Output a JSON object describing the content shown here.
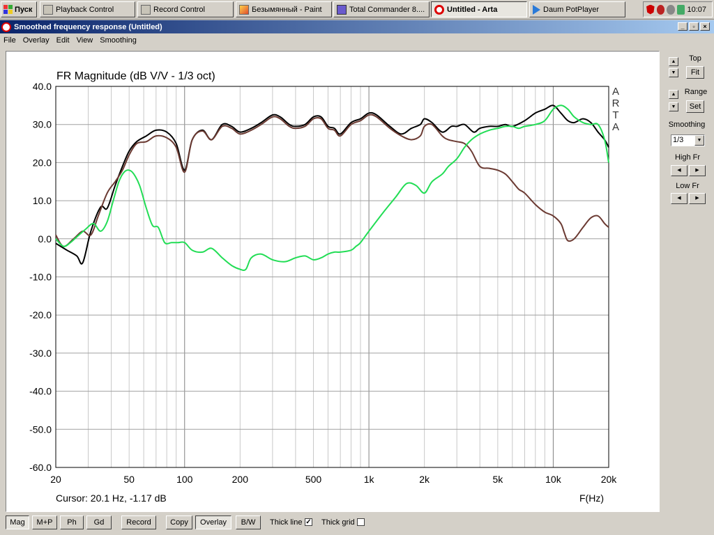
{
  "taskbar": {
    "start_label": "Пуск",
    "tasks": [
      {
        "label": "Playback Control",
        "icon": "mixer-icon"
      },
      {
        "label": "Record Control",
        "icon": "mixer-icon"
      },
      {
        "label": "Безымянный - Paint",
        "icon": "paint-icon"
      },
      {
        "label": "Total Commander 8....",
        "icon": "floppy-icon"
      },
      {
        "label": "Untitled - Arta",
        "icon": "arta-icon"
      },
      {
        "label": "Daum PotPlayer",
        "icon": "play-icon"
      }
    ],
    "clock": "10:07"
  },
  "window": {
    "title": "Smoothed frequency response (Untitled)",
    "controls": [
      "_",
      "▫",
      "×"
    ]
  },
  "menu": [
    "File",
    "Overlay",
    "Edit",
    "View",
    "Smoothing"
  ],
  "chart_data": {
    "type": "line",
    "title": "FR Magnitude (dB V/V - 1/3 oct)",
    "xlabel": "F(Hz)",
    "ylabel": "",
    "x_scale": "log",
    "xlim": [
      20,
      20000
    ],
    "ylim": [
      -60,
      40
    ],
    "x_ticks": [
      {
        "v": 20,
        "label": "20"
      },
      {
        "v": 50,
        "label": "50"
      },
      {
        "v": 100,
        "label": "100"
      },
      {
        "v": 200,
        "label": "200"
      },
      {
        "v": 500,
        "label": "500"
      },
      {
        "v": 1000,
        "label": "1k"
      },
      {
        "v": 2000,
        "label": "2k"
      },
      {
        "v": 5000,
        "label": "5k"
      },
      {
        "v": 10000,
        "label": "10k"
      },
      {
        "v": 20000,
        "label": "20k"
      }
    ],
    "y_ticks": [
      {
        "v": 40,
        "label": "40.0"
      },
      {
        "v": 30,
        "label": "30.0"
      },
      {
        "v": 20,
        "label": "20.0"
      },
      {
        "v": 10,
        "label": "10.0"
      },
      {
        "v": 0,
        "label": "0.0"
      },
      {
        "v": -10,
        "label": "-10.0"
      },
      {
        "v": -20,
        "label": "-20.0"
      },
      {
        "v": -30,
        "label": "-30.0"
      },
      {
        "v": -40,
        "label": "-40.0"
      },
      {
        "v": -50,
        "label": "-50.0"
      },
      {
        "v": -60,
        "label": "-60.0"
      }
    ],
    "grid": true,
    "watermark": [
      "A",
      "R",
      "T",
      "A"
    ],
    "cursor_text": "Cursor: 20.1 Hz, -1.17 dB",
    "series": [
      {
        "color": "#000000",
        "x": [
          20,
          23,
          26,
          28,
          31,
          35,
          38,
          42,
          46,
          50,
          55,
          62,
          70,
          80,
          90,
          100,
          110,
          125,
          140,
          160,
          180,
          200,
          230,
          260,
          300,
          330,
          370,
          400,
          450,
          500,
          550,
          600,
          650,
          700,
          800,
          900,
          1000,
          1100,
          1300,
          1500,
          1700,
          1900,
          2000,
          2200,
          2500,
          2800,
          3000,
          3300,
          3700,
          4000,
          4500,
          5000,
          5500,
          6000,
          7000,
          8000,
          9000,
          10000,
          11000,
          12000,
          13000,
          14500,
          16000,
          17500,
          19000,
          20000
        ],
        "y": [
          -1.2,
          -3,
          -4.5,
          -6.3,
          2,
          8.3,
          8,
          14,
          19,
          23,
          25.5,
          27,
          28.5,
          28,
          25,
          18,
          26,
          28.5,
          26,
          30,
          29.5,
          28,
          29,
          30.5,
          32.5,
          32,
          30,
          29.5,
          30,
          32,
          32,
          29.5,
          29,
          27.5,
          30.5,
          31.5,
          33,
          32.5,
          29.5,
          27.5,
          29,
          30,
          31.5,
          30.5,
          28,
          29.5,
          29.5,
          30,
          28,
          29,
          29.5,
          29.5,
          30,
          29.5,
          31,
          33,
          34,
          35,
          33,
          31,
          30.5,
          31.5,
          30.5,
          28,
          26,
          24
        ]
      },
      {
        "color": "#6b3a32",
        "x": [
          20,
          22,
          25,
          28,
          31,
          34,
          38,
          42,
          46,
          50,
          55,
          62,
          70,
          80,
          90,
          100,
          110,
          125,
          140,
          160,
          180,
          200,
          230,
          260,
          300,
          330,
          370,
          400,
          450,
          500,
          550,
          600,
          650,
          700,
          800,
          900,
          1000,
          1100,
          1300,
          1500,
          1700,
          1900,
          2000,
          2200,
          2500,
          2700,
          3000,
          3300,
          3600,
          4000,
          4500,
          5000,
          5500,
          6000,
          6500,
          7000,
          8000,
          9000,
          10000,
          11000,
          11500,
          12000,
          13000,
          14500,
          16000,
          17500,
          19000,
          20000
        ],
        "y": [
          1,
          -2,
          0,
          2,
          1,
          6,
          12,
          15,
          18,
          22,
          25,
          25.5,
          27,
          26.5,
          24,
          17.5,
          26,
          28.3,
          26,
          29.5,
          29,
          27.5,
          28.5,
          30,
          32,
          31.5,
          29.5,
          29,
          29.5,
          31.5,
          31.5,
          29,
          28.5,
          27,
          30,
          31,
          32.5,
          32,
          29,
          27,
          26,
          27,
          29.5,
          30,
          27,
          26,
          25.5,
          25,
          23,
          19,
          18.5,
          18,
          17,
          15,
          13,
          12,
          9,
          7,
          6,
          4,
          1.5,
          -0.5,
          0,
          3,
          5.5,
          6,
          4,
          3
        ]
      },
      {
        "color": "#22dd55",
        "x": [
          20,
          22,
          24,
          26,
          29,
          32,
          35,
          38,
          41,
          44,
          47,
          50,
          53,
          57,
          62,
          67,
          72,
          78,
          85,
          92,
          100,
          110,
          125,
          140,
          160,
          180,
          200,
          215,
          230,
          260,
          300,
          350,
          400,
          450,
          500,
          550,
          600,
          650,
          700,
          800,
          850,
          900,
          1000,
          1200,
          1400,
          1600,
          1800,
          2000,
          2200,
          2500,
          2700,
          3000,
          3300,
          3600,
          4000,
          4500,
          5000,
          5500,
          6000,
          6500,
          7000,
          8000,
          9000,
          10000,
          11000,
          12000,
          13000,
          14500,
          16000,
          17500,
          19000,
          20000
        ],
        "y": [
          0,
          -2,
          -1,
          0.5,
          2.5,
          4,
          2,
          4.5,
          10,
          15,
          17.5,
          18,
          17,
          14,
          8,
          3.5,
          3,
          -1,
          -1,
          -1,
          -1,
          -3,
          -3.5,
          -2.5,
          -5,
          -7,
          -8,
          -8,
          -5,
          -4,
          -5.5,
          -6,
          -5,
          -4.5,
          -5.5,
          -5,
          -4,
          -3.5,
          -3.5,
          -3,
          -2,
          -1,
          2,
          7,
          11,
          14.5,
          14,
          12,
          15,
          17,
          19,
          21,
          24,
          26,
          27.5,
          28.5,
          29,
          29.5,
          29.5,
          29,
          29.5,
          30,
          31,
          34,
          35,
          34,
          32,
          30.5,
          30,
          30,
          26,
          20
        ]
      }
    ]
  },
  "side_panel": {
    "top_label": "Top",
    "fit_label": "Fit",
    "range_label": "Range",
    "set_label": "Set",
    "smoothing_label": "Smoothing",
    "smoothing_value": "1/3",
    "high_fr_label": "High Fr",
    "low_fr_label": "Low Fr"
  },
  "bottom": {
    "buttons": [
      "Mag",
      "M+P",
      "Ph",
      "Gd",
      "Record",
      "Copy",
      "Overlay",
      "B/W"
    ],
    "thick_line_label": "Thick line",
    "thick_line_checked": true,
    "thick_grid_label": "Thick grid",
    "thick_grid_checked": false,
    "check_glyph": "✓"
  }
}
